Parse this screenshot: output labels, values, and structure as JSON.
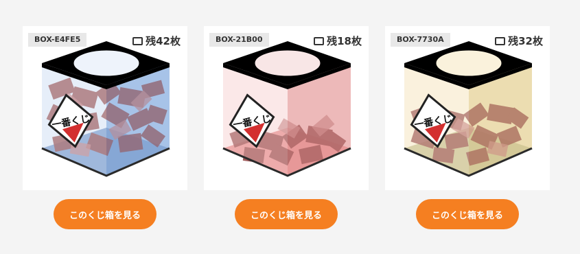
{
  "cards": [
    {
      "box_id": "BOX-E4FE5",
      "remain": "残42枚",
      "button_label": "このくじ箱を見る",
      "tint_light": "#e6eef9",
      "tint_dark": "#9fbde6",
      "floor_color": "#7a9ccc",
      "hole_color": "#eef3fb",
      "fill_level": 0.9
    },
    {
      "box_id": "BOX-21B00",
      "remain": "残18枚",
      "button_label": "このくじ箱を見る",
      "tint_light": "#fbe9e9",
      "tint_dark": "#ebb2b2",
      "floor_color": "#e58a8a",
      "hole_color": "#f8e6e6",
      "fill_level": 0.45
    },
    {
      "box_id": "BOX-7730A",
      "remain": "残32枚",
      "button_label": "このくじ箱を見る",
      "tint_light": "#faf1de",
      "tint_dark": "#ead9a8",
      "floor_color": "#c8c08f",
      "hole_color": "#faf2dc",
      "fill_level": 0.65
    }
  ],
  "logo_text": "一番くじ"
}
